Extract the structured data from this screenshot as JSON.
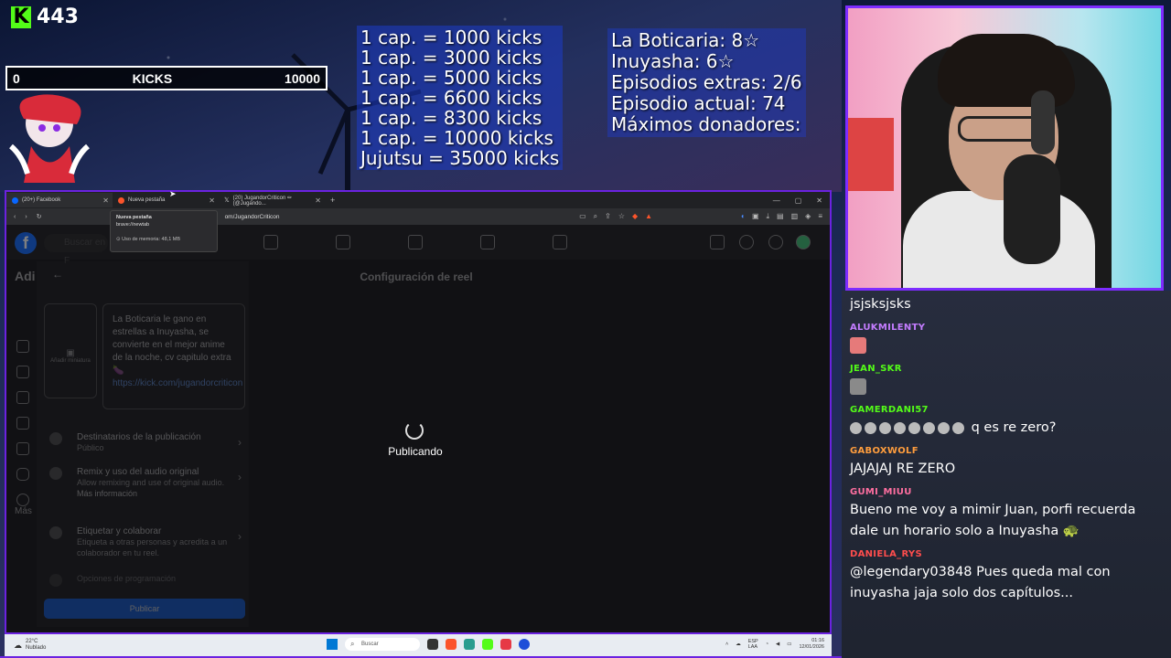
{
  "stream": {
    "kick_count": "443",
    "kicks_bar": {
      "min": "0",
      "label": "KICKS",
      "max": "10000"
    },
    "caps_lines": [
      "1 cap. = 1000 kicks",
      "1 cap. = 3000 kicks",
      "1 cap. = 5000 kicks",
      "1 cap. = 6600 kicks",
      "1 cap. = 8300 kicks",
      "1 cap. = 10000 kicks",
      "Jujutsu = 35000 kicks"
    ],
    "stats_lines": [
      "La Boticaria: 8☆",
      "Inuyasha: 6☆",
      "Episodios extras: 2/6",
      "Episodio actual: 74",
      "Máximos donadores:"
    ]
  },
  "browser": {
    "tabs": [
      {
        "label": "(20+) Facebook",
        "color": "#0866ff"
      },
      {
        "label": "Nueva pestaña",
        "color": "#fb542b"
      },
      {
        "label": "(20) JugandorCriticon ✏ (@Jugando...",
        "color": "#cccccc"
      }
    ],
    "new_tab": "+",
    "url": "om/JugandorCriticon",
    "tooltip": {
      "title": "Nueva pestaña",
      "url": "brave://newtab",
      "memory": "Uso de memoria: 48,1 MB"
    }
  },
  "facebook": {
    "search_placeholder": "Buscar en F",
    "side_title": "Adi",
    "more_label": "Más",
    "header_title": "Configuración de reel",
    "thumb_label": "Añadir miniatura",
    "caption": "La Boticaria le gano en estrellas a Inuyasha, se convierte en el mejor anime de la noche, cv capitulo extra 🍆",
    "caption_link": "https://kick.com/jugandorcriticon",
    "options": [
      {
        "title": "Destinatarios de la publicación",
        "sub": "Público"
      },
      {
        "title": "Remix y uso del audio original",
        "sub": "Allow remixing and use of original audio.",
        "link": "Más información"
      },
      {
        "title": "Etiquetar y colaborar",
        "sub": "Etiqueta a otras personas y acredita a un colaborador en tu reel."
      },
      {
        "title": "Opciones de programación",
        "sub": ""
      }
    ],
    "publish_button": "Publicar",
    "status": "Publicando"
  },
  "taskbar": {
    "temp": "22°C",
    "weather": "Nublado",
    "search": "Buscar",
    "lang": "ESP\nLAA",
    "time": "01:16",
    "date": "12/01/2026"
  },
  "chat": [
    {
      "user": "",
      "color": "#ffffff",
      "text": "jsjsksjsks"
    },
    {
      "user": "ALUKMILENTY",
      "color": "#c47dff",
      "text": "",
      "emote": "#e67a7a"
    },
    {
      "user": "JEAN_SKR",
      "color": "#53fc18",
      "text": "",
      "emote": "#8a8a8a"
    },
    {
      "user": "GAMERDANI57",
      "color": "#53fc18",
      "text": "q es re zero?",
      "emotes": 8
    },
    {
      "user": "GABOXWOLF",
      "color": "#ff9d3d",
      "text": "JAJAJAJ RE ZERO"
    },
    {
      "user": "GUMI_MIUU",
      "color": "#ff6fa0",
      "text": "Bueno me voy a mimir Juan, porfi recuerda dale un horario solo a Inuyasha 🐢"
    },
    {
      "user": "DANIELA_RYS",
      "color": "#ff4d4d",
      "text": "@legendary03848 Pues queda mal con inuyasha jaja solo dos capítulos..."
    }
  ]
}
